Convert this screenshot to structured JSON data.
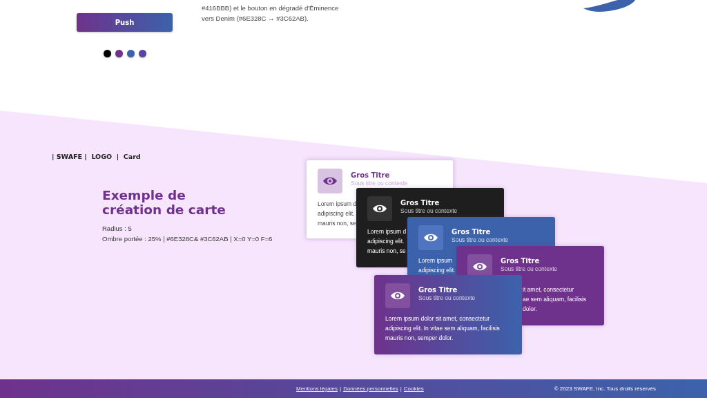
{
  "top": {
    "button": "Push",
    "dots": [
      {
        "color": "#000000"
      },
      {
        "color": "#6e328c"
      },
      {
        "color": "#3c62ab"
      },
      {
        "color": "#5a46a0"
      }
    ],
    "paragraph": [
      "#416BBB) et le bouton en dégradé d'Éminence",
      "vers Denim (#6E328C → #3C62AB)."
    ]
  },
  "section": {
    "breadcrumb": "| SWAFE |  LOGO  |  Card",
    "heading": [
      "Exemple de",
      "création de carte"
    ],
    "specs": [
      "Radius : 5",
      "Ombre portée : 25% | #6E328C& #3C62AB | X=0  Y=0  F=6"
    ],
    "cards": [
      {
        "kind": "light",
        "title": "Gros Titre",
        "subtitle": "Sous titre ou contexte",
        "lines": [
          "Lorem ipsum d",
          "adipiscing elit.",
          "mauris non, se"
        ]
      },
      {
        "kind": "dark",
        "title": "Gros Titre",
        "subtitle": "Sous titre ou contexte",
        "lines": [
          "Lorem ipsum d",
          "adipiscing elit.",
          "mauris non, se"
        ]
      },
      {
        "kind": "blue",
        "title": "Gros Titre",
        "subtitle": "Sous titre ou contexte",
        "lines": [
          "Lorem ipsum",
          "adipiscing elit."
        ]
      },
      {
        "kind": "purple",
        "title": "Gros Titre",
        "subtitle": "Sous titre ou contexte",
        "lines": [
          "it amet, consectetur",
          "ae sem aliquam, facilisis",
          "dolor."
        ]
      },
      {
        "kind": "gradient",
        "title": "Gros Titre",
        "subtitle": "Sous titre ou contexte",
        "lines": [
          "Lorem ipsum dolor sit amet, consectetur",
          "adipiscing elit. In vitae sem aliquam, facilisis",
          "mauris non, semper dolor."
        ]
      }
    ]
  },
  "footer": {
    "items": [
      {
        "kind": "link",
        "text": "Mentions légales"
      },
      {
        "kind": "separator",
        "text": "|"
      },
      {
        "kind": "link",
        "text": "Données personnelles"
      },
      {
        "kind": "separator",
        "text": "|"
      },
      {
        "kind": "link",
        "text": "Cookies"
      }
    ],
    "copyright": "© 2023 SWAFE, Inc. Tous droits réservés"
  }
}
